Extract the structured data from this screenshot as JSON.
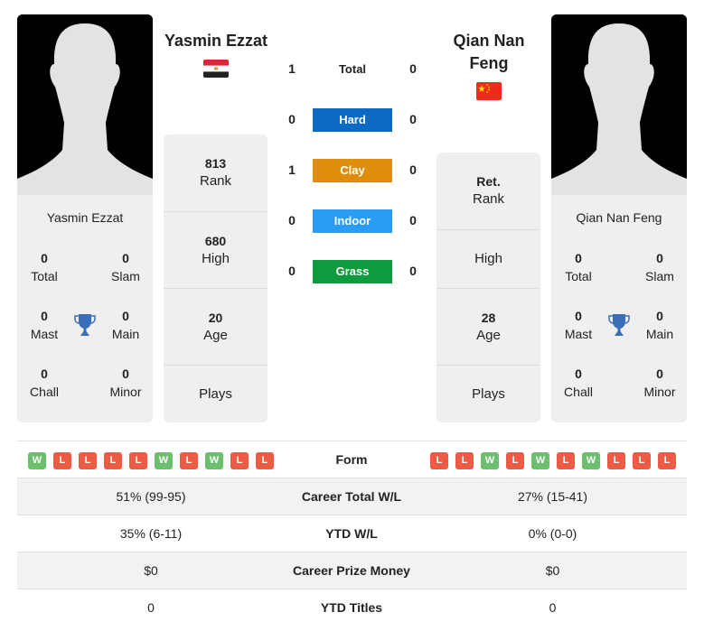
{
  "player1": {
    "name": "Yasmin Ezzat",
    "country": "Egypt",
    "flag_icon": "egypt-flag-icon",
    "titles": {
      "total": "0",
      "slam": "0",
      "mast": "0",
      "main": "0",
      "chall": "0",
      "minor": "0"
    },
    "labels": {
      "total": "Total",
      "slam": "Slam",
      "mast": "Mast",
      "main": "Main",
      "chall": "Chall",
      "minor": "Minor"
    },
    "rank": "813",
    "rank_label": "Rank",
    "high": "680",
    "high_label": "High",
    "age": "20",
    "age_label": "Age",
    "plays": "",
    "plays_label": "Plays",
    "form": [
      "W",
      "L",
      "L",
      "L",
      "L",
      "W",
      "L",
      "W",
      "L",
      "L"
    ]
  },
  "player2": {
    "name": "Qian Nan Feng",
    "name_line1": "Qian Nan",
    "name_line2": "Feng",
    "country": "China",
    "flag_icon": "china-flag-icon",
    "titles": {
      "total": "0",
      "slam": "0",
      "mast": "0",
      "main": "0",
      "chall": "0",
      "minor": "0"
    },
    "labels": {
      "total": "Total",
      "slam": "Slam",
      "mast": "Mast",
      "main": "Main",
      "chall": "Chall",
      "minor": "Minor"
    },
    "rank": "Ret.",
    "rank_label": "Rank",
    "high": "",
    "high_label": "High",
    "age": "28",
    "age_label": "Age",
    "plays": "",
    "plays_label": "Plays",
    "form": [
      "L",
      "L",
      "W",
      "L",
      "W",
      "L",
      "W",
      "L",
      "L",
      "L"
    ]
  },
  "h2h": [
    {
      "label": "Total",
      "p1": "1",
      "p2": "0",
      "color": ""
    },
    {
      "label": "Hard",
      "p1": "0",
      "p2": "0",
      "color": "#0a6ac4"
    },
    {
      "label": "Clay",
      "p1": "1",
      "p2": "0",
      "color": "#de8e0b"
    },
    {
      "label": "Indoor",
      "p1": "0",
      "p2": "0",
      "color": "#2a9cf4"
    },
    {
      "label": "Grass",
      "p1": "0",
      "p2": "0",
      "color": "#0f9a3e"
    }
  ],
  "stats": {
    "form_label": "Form",
    "rows": [
      {
        "label": "Career Total W/L",
        "p1": "51% (99-95)",
        "p2": "27% (15-41)"
      },
      {
        "label": "YTD W/L",
        "p1": "35% (6-11)",
        "p2": "0% (0-0)"
      },
      {
        "label": "Career Prize Money",
        "p1": "$0",
        "p2": "$0"
      },
      {
        "label": "YTD Titles",
        "p1": "0",
        "p2": "0"
      }
    ]
  },
  "colors": {
    "win": "#6cbf6c",
    "loss": "#ee5b44",
    "trophy": "#3a6fb8",
    "card_bg": "#efefef"
  }
}
